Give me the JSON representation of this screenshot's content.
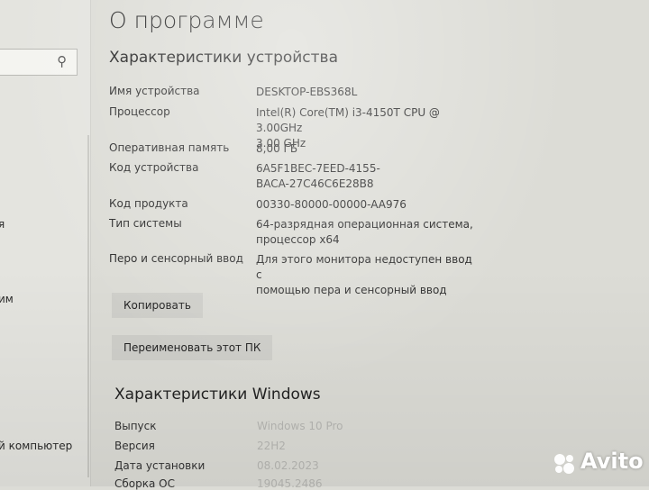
{
  "nav": {
    "items": [
      {
        "label": "я"
      },
      {
        "label": "им"
      },
      {
        "label": "й компьютер"
      }
    ]
  },
  "page": {
    "title": "О программе"
  },
  "device_specs": {
    "title": "Характеристики устройства",
    "rows": [
      {
        "label": "Имя устройства",
        "value": "DESKTOP-EBS368L"
      },
      {
        "label": "Процессор",
        "value": "Intel(R) Core(TM) i3-4150T CPU @ 3.00GHz",
        "value2": "3.00 GHz"
      },
      {
        "label": "Оперативная память",
        "value": "8,00 ГБ"
      },
      {
        "label": "Код устройства",
        "value": "6A5F1BEC-7EED-4155-",
        "value2": "BACA-27C46C6E28B8"
      },
      {
        "label": "Код продукта",
        "value": "00330-80000-00000-AA976"
      },
      {
        "label": "Тип системы",
        "value": "64-разрядная операционная система,",
        "value2": "процессор x64"
      },
      {
        "label": "Перо и сенсорный ввод",
        "value": "Для этого монитора недоступен ввод с",
        "value2": "помощью пера и сенсорный ввод"
      }
    ],
    "copy_button": "Копировать",
    "rename_button": "Переименовать этот ПК"
  },
  "windows_specs": {
    "title": "Характеристики Windows",
    "rows": [
      {
        "label": "Выпуск",
        "value": "Windows 10 Pro"
      },
      {
        "label": "Версия",
        "value": "22H2"
      },
      {
        "label": "Дата установки",
        "value": "08.02.2023"
      },
      {
        "label": "Сборка ОС",
        "value": "19045.2486"
      }
    ]
  },
  "watermark": {
    "text": "Avito",
    "icon": "avito-logo-icon"
  }
}
